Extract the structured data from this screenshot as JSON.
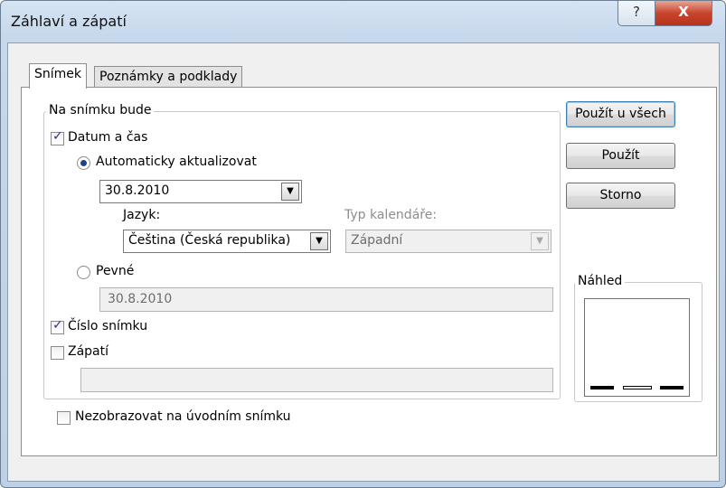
{
  "window": {
    "title": "Záhlaví a zápatí",
    "help_glyph": "?",
    "close_glyph": "X"
  },
  "tabs": [
    {
      "label": "Snímek",
      "active": true
    },
    {
      "label": "Poznámky a podklady",
      "active": false
    }
  ],
  "group": {
    "legend": "Na snímku bude",
    "date_time": {
      "label": "Datum a čas",
      "checked": true
    },
    "auto_update": {
      "label": "Automaticky aktualizovat",
      "selected": true
    },
    "date_combo": {
      "value": "30.8.2010"
    },
    "language": {
      "label": "Jazyk:",
      "value": "Čeština (Česká republika)"
    },
    "calendar": {
      "label": "Typ kalendáře:",
      "value": "Západní"
    },
    "fixed": {
      "label": "Pevné",
      "selected": false,
      "value": "30.8.2010"
    },
    "slide_number": {
      "label": "Číslo snímku",
      "checked": true
    },
    "footer": {
      "label": "Zápatí",
      "checked": false,
      "value": ""
    }
  },
  "dont_show_title": {
    "label": "Nezobrazovat na úvodním snímku",
    "checked": false
  },
  "buttons": {
    "apply_all": "Použít u všech",
    "apply": "Použít",
    "cancel": "Storno"
  },
  "preview": {
    "legend": "Náhled"
  },
  "icons": {
    "combo_arrow": "▼"
  }
}
